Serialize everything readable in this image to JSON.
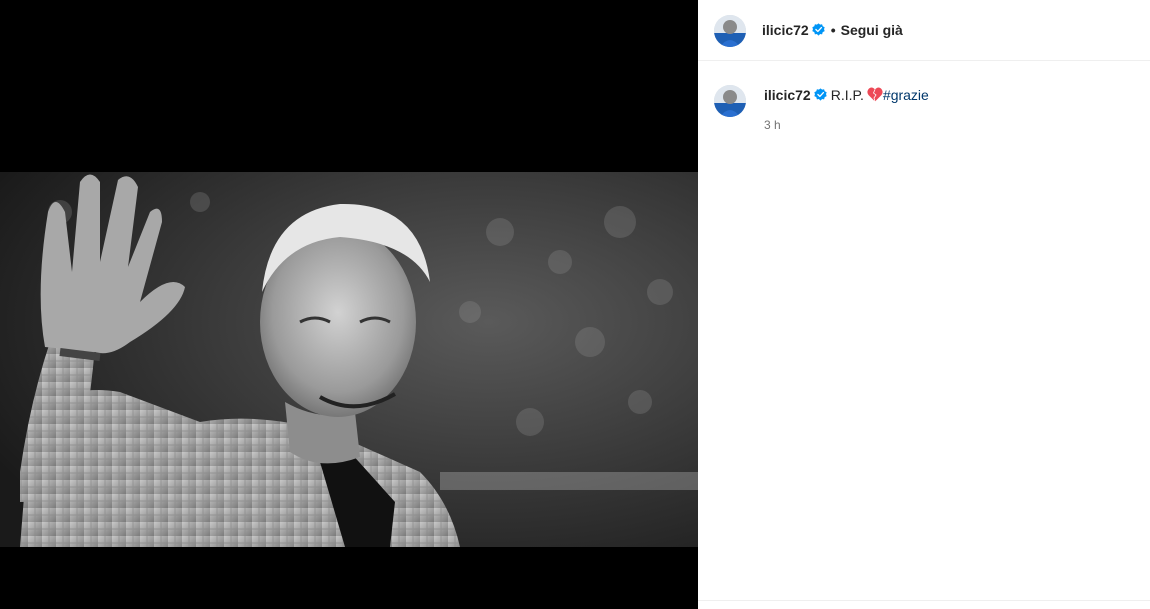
{
  "post": {
    "author": "ilicic72",
    "verified": true,
    "follow_state": "Segui già",
    "separator": "•",
    "caption": {
      "author": "ilicic72",
      "text": "R.I.P.",
      "emoji": "broken-heart-icon",
      "hashtag": "#grazie",
      "time": "3 h"
    },
    "image": {
      "style": "black-and-white",
      "subject": "man-waving"
    }
  },
  "colors": {
    "text": "#262626",
    "secondary_text": "#737373",
    "hashtag": "#00376b",
    "verified": "#0095f6",
    "heart": "#ed4956",
    "media_background": "#000000"
  }
}
